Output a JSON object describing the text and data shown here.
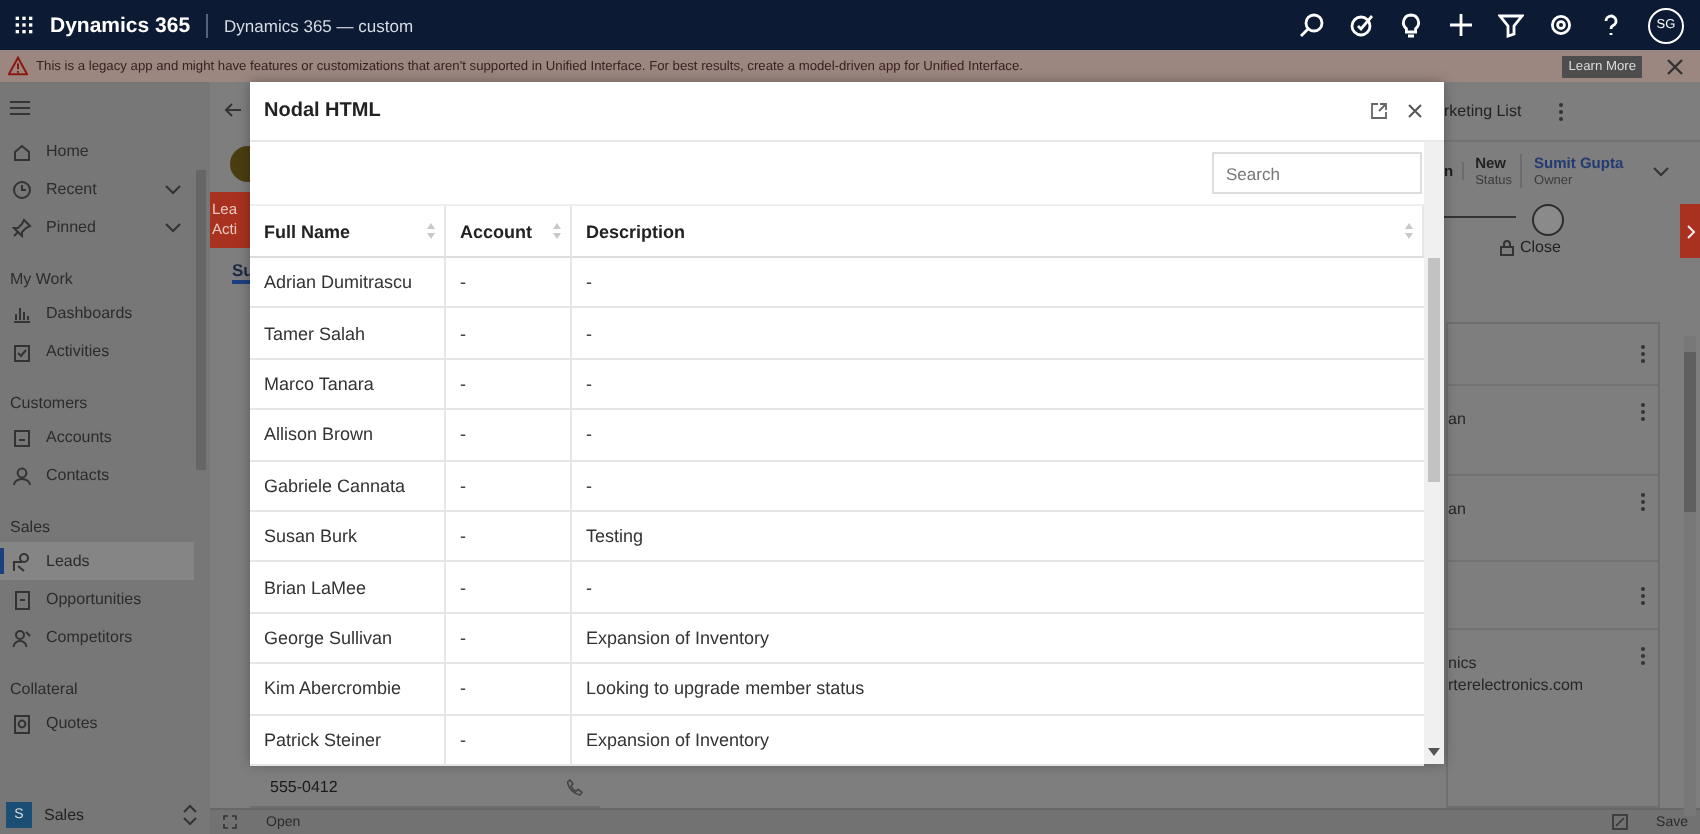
{
  "header": {
    "app_name": "Dynamics 365",
    "app_title": "Dynamics 365 — custom",
    "avatar": "SG"
  },
  "banner": {
    "message": "This is a legacy app and might have features or customizations that aren't supported in Unified Interface. For best results, create a model-driven app for Unified Interface.",
    "button": "Learn More"
  },
  "sidebar": {
    "items": [
      {
        "kind": "item",
        "label": "Home",
        "selected": false
      },
      {
        "kind": "item",
        "label": "Recent",
        "selected": false,
        "expanded": false
      },
      {
        "kind": "item",
        "label": "Pinned",
        "selected": false,
        "expanded": false
      },
      {
        "kind": "heading",
        "label": "My Work"
      },
      {
        "kind": "item",
        "label": "Dashboards",
        "selected": false
      },
      {
        "kind": "item",
        "label": "Activities",
        "selected": false
      },
      {
        "kind": "heading",
        "label": "Customers"
      },
      {
        "kind": "item",
        "label": "Accounts",
        "selected": false
      },
      {
        "kind": "item",
        "label": "Contacts",
        "selected": false
      },
      {
        "kind": "heading",
        "label": "Sales"
      },
      {
        "kind": "item",
        "label": "Leads",
        "selected": true
      },
      {
        "kind": "item",
        "label": "Opportunities",
        "selected": false
      },
      {
        "kind": "item",
        "label": "Competitors",
        "selected": false
      },
      {
        "kind": "heading",
        "label": "Collateral"
      },
      {
        "kind": "item",
        "label": "Quotes",
        "selected": false
      }
    ],
    "area": {
      "badge": "S",
      "label": "Sales"
    }
  },
  "record": {
    "tag": [
      "Lea",
      "Acti"
    ],
    "tab": "Su",
    "command": "rketing List",
    "fields": [
      {
        "value": "n"
      },
      {
        "value": "New",
        "label": "Status"
      },
      {
        "value": "Sumit Gupta",
        "label": "Owner",
        "kind": "link"
      }
    ],
    "stage": "Close",
    "cards": [
      {
        "kind": "blank"
      },
      {
        "lines": [
          "an"
        ]
      },
      {
        "lines": [
          "an"
        ]
      },
      {
        "kind": "blank"
      },
      {
        "lines": [
          "nics",
          "rterelectronics.com"
        ]
      }
    ],
    "phone": "555-0412"
  },
  "dialog": {
    "title": "Nodal HTML",
    "search": {
      "placeholder": "Search"
    },
    "table": {
      "columns": [
        "Full Name",
        "Account",
        "Description"
      ],
      "rows": [
        {
          "cells": [
            "Adrian Dumitrascu",
            "-",
            "-"
          ]
        },
        {
          "cells": [
            "Tamer Salah",
            "-",
            "-"
          ]
        },
        {
          "cells": [
            "Marco Tanara",
            "-",
            "-"
          ]
        },
        {
          "cells": [
            "Allison Brown",
            "-",
            "-"
          ]
        },
        {
          "cells": [
            "Gabriele Cannata",
            "-",
            "-"
          ]
        },
        {
          "cells": [
            "Susan Burk",
            "-",
            "Testing"
          ]
        },
        {
          "cells": [
            "Brian LaMee",
            "-",
            "-"
          ]
        },
        {
          "cells": [
            "George Sullivan",
            "-",
            "Expansion of Inventory"
          ]
        },
        {
          "cells": [
            "Kim Abercrombie",
            "-",
            "Looking to upgrade member status"
          ]
        },
        {
          "cells": [
            "Patrick Steiner",
            "-",
            "Expansion of Inventory"
          ]
        }
      ]
    }
  },
  "status_bar": {
    "left": "Open",
    "right": "Save"
  }
}
